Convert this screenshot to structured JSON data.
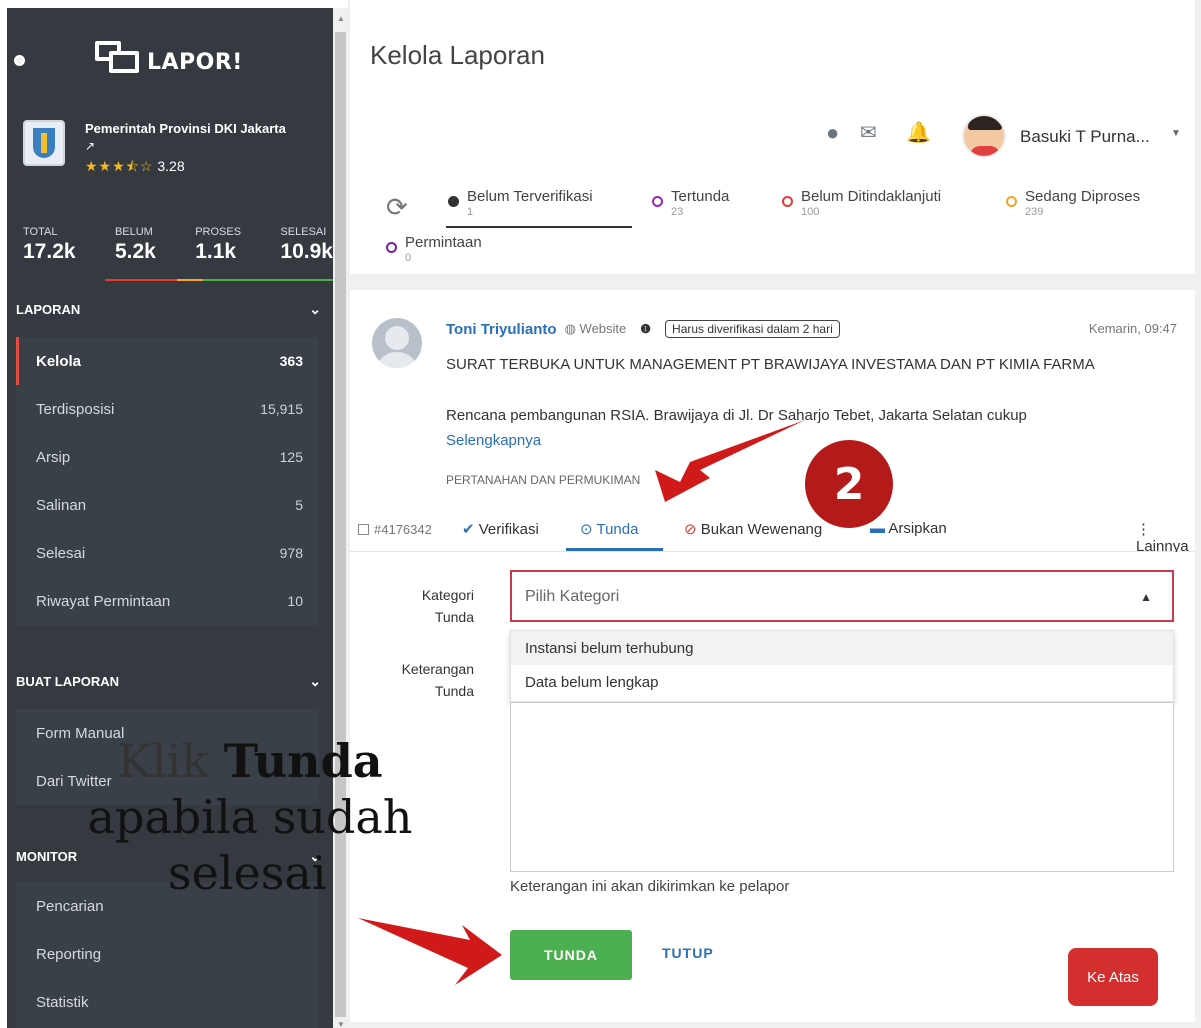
{
  "app": {
    "brand": "LAPOR!"
  },
  "org": {
    "name": "Pemerintah Provinsi DKI Jakarta",
    "stars": "★★★⯪☆",
    "rating": "3.28"
  },
  "stats": [
    {
      "label": "TOTAL",
      "value": "17.2k"
    },
    {
      "label": "BELUM",
      "value": "5.2k"
    },
    {
      "label": "PROSES",
      "value": "1.1k"
    },
    {
      "label": "SELESAI",
      "value": "10.9k"
    }
  ],
  "sidebar": {
    "laporan_title": "LAPORAN",
    "laporan_items": [
      {
        "label": "Kelola",
        "count": "363"
      },
      {
        "label": "Terdisposisi",
        "count": "15,915"
      },
      {
        "label": "Arsip",
        "count": "125"
      },
      {
        "label": "Salinan",
        "count": "5"
      },
      {
        "label": "Selesai",
        "count": "978"
      },
      {
        "label": "Riwayat Permintaan",
        "count": "10"
      }
    ],
    "buat_title": "BUAT LAPORAN",
    "buat_items": [
      {
        "label": "Form Manual"
      },
      {
        "label": "Dari Twitter"
      }
    ],
    "monitor_title": "MONITOR",
    "monitor_items": [
      {
        "label": "Pencarian"
      },
      {
        "label": "Reporting"
      },
      {
        "label": "Statistik"
      }
    ]
  },
  "header": {
    "title": "Kelola Laporan",
    "user_name": "Basuki T Purna..."
  },
  "status_tabs": [
    {
      "label": "Belum Terverifikasi",
      "count": "1",
      "color": "#333333"
    },
    {
      "label": "Tertunda",
      "count": "23",
      "color": "#9c27b0"
    },
    {
      "label": "Belum Ditindaklanjuti",
      "count": "100",
      "color": "#e53935"
    },
    {
      "label": "Sedang Diproses",
      "count": "239",
      "color": "#f5a623"
    },
    {
      "label": "Permintaan",
      "count": "0",
      "color": "#7b1fa2"
    }
  ],
  "report": {
    "author": "Toni Triyulianto",
    "source": "Website",
    "badge": "Harus diverifikasi dalam 2 hari",
    "time": "Kemarin, 09:47",
    "title": "SURAT TERBUKA UNTUK MANAGEMENT PT BRAWIJAYA INVESTAMA DAN PT KIMIA FARMA",
    "body": "Rencana pembangunan RSIA. Brawijaya di Jl. Dr Saharjo Tebet, Jakarta Selatan cukup",
    "more": "Selengkapnya",
    "category": "PERTANAHAN DAN PERMUKIMAN"
  },
  "actions": {
    "id": "#4176342",
    "verifikasi": "Verifikasi",
    "tunda": "Tunda",
    "bukan": "Bukan Wewenang",
    "arsipkan": "Arsipkan",
    "lainnya": "Lainnya"
  },
  "form": {
    "kategori_label_1": "Kategori",
    "kategori_label_2": "Tunda",
    "select_placeholder": "Pilih Kategori",
    "options": [
      "Instansi belum terhubung",
      "Data belum lengkap"
    ],
    "keterangan_label_1": "Keterangan",
    "keterangan_label_2": "Tunda",
    "help": "Keterangan ini akan dikirimkan ke pelapor",
    "tunda_button": "TUNDA",
    "tutup_button": "TUTUP",
    "ke_atas_button": "Ke Atas"
  },
  "annotation": {
    "line1_plain": "Klik ",
    "line1_bold": "Tunda",
    "line2": "apabila sudah",
    "line3": "selesai",
    "step": "2"
  },
  "colors": {
    "sidebar": "#343a40",
    "accent": "#2a70b8",
    "alert": "#c93a4c",
    "success": "#4caf50"
  }
}
